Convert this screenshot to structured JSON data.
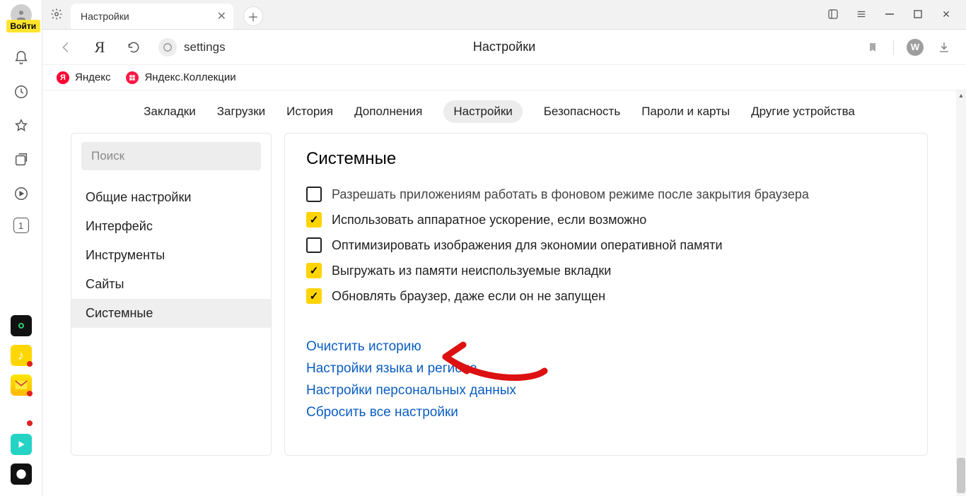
{
  "sidebar": {
    "login_label": "Войти",
    "notebook_count": "1"
  },
  "tab": {
    "title": "Настройки"
  },
  "address": {
    "url_text": "settings",
    "page_title": "Настройки",
    "ext_badge": "W"
  },
  "bookmarks": [
    {
      "label": "Яндекс"
    },
    {
      "label": "Яндекс.Коллекции"
    }
  ],
  "settings_nav": {
    "items": [
      "Закладки",
      "Загрузки",
      "История",
      "Дополнения",
      "Настройки",
      "Безопасность",
      "Пароли и карты",
      "Другие устройства"
    ],
    "active": "Настройки"
  },
  "leftpanel": {
    "search_placeholder": "Поиск",
    "items": [
      "Общие настройки",
      "Интерфейс",
      "Инструменты",
      "Сайты",
      "Системные"
    ],
    "active": "Системные"
  },
  "rightpanel": {
    "heading": "Системные",
    "options": [
      {
        "label": "Разрешать приложениям работать в фоновом режиме после закрытия браузера",
        "checked": false,
        "cut": true
      },
      {
        "label": "Использовать аппаратное ускорение, если возможно",
        "checked": true
      },
      {
        "label": "Оптимизировать изображения для экономии оперативной памяти",
        "checked": false
      },
      {
        "label": "Выгружать из памяти неиспользуемые вкладки",
        "checked": true
      },
      {
        "label": "Обновлять браузер, даже если он не запущен",
        "checked": true
      }
    ],
    "links": [
      "Очистить историю",
      "Настройки языка и региона",
      "Настройки персональных данных",
      "Сбросить все настройки"
    ]
  }
}
